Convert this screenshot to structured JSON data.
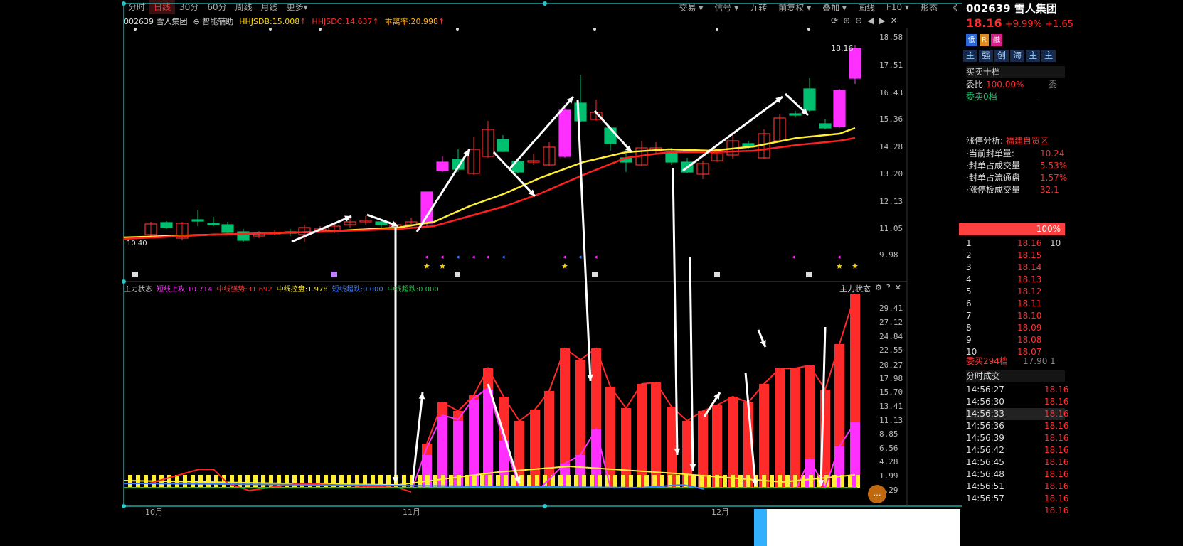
{
  "toolbar": {
    "tabs": [
      {
        "label": "分时"
      },
      {
        "label": "日线"
      },
      {
        "label": "30分"
      },
      {
        "label": "60分"
      },
      {
        "label": "周线"
      },
      {
        "label": "月线"
      },
      {
        "label": "更多▾"
      }
    ],
    "right": [
      {
        "label": "交易 ▾"
      },
      {
        "label": "信号 ▾"
      },
      {
        "label": "九转"
      },
      {
        "label": "前复权 ▾"
      },
      {
        "label": "叠加 ▾"
      },
      {
        "label": "画线"
      },
      {
        "label": "F10 ▾"
      },
      {
        "label": "形态"
      }
    ],
    "collapse": "《"
  },
  "infobar": {
    "code_name": "002639 雪人集团",
    "assist": "智能辅助",
    "hhjsdb": "HHJSDB:15.008",
    "hhjsdc": "HHJSDC:14.637",
    "deviation": "乖离率:20.998"
  },
  "main": {
    "y_ticks": [
      "18.58",
      "17.51",
      "16.43",
      "15.36",
      "14.28",
      "13.20",
      "12.13",
      "11.05",
      "9.98"
    ],
    "last_price_label": "18.16",
    "low_label": "10.40",
    "colors": {
      "up": "#ff2a2a",
      "down": "#00c070",
      "limit": "#ff30ff",
      "ma_fast": "#ffee33",
      "ma_slow": "#ff2020"
    }
  },
  "sub": {
    "title": "主力状态",
    "short_up": "短线上攻:10.714",
    "mid_strong": "中线强势:31.692",
    "mid_ctrl": "中线控盘:1.978",
    "short_fall": "短线超跌:0.000",
    "mid_fall": "中线超跌:0.000",
    "right_title": "主力状态",
    "y_ticks": [
      "29.41",
      "27.12",
      "24.84",
      "22.55",
      "20.27",
      "17.98",
      "15.70",
      "13.41",
      "11.13",
      "8.85",
      "6.56",
      "4.28",
      "1.99",
      "0.29"
    ]
  },
  "xaxis": {
    "labels": [
      "10月",
      "11月",
      "12月"
    ]
  },
  "side": {
    "code": "002639",
    "name": "雪人集团",
    "price": "18.16",
    "pct": "+9.99%",
    "chg": "+1.65",
    "tags": [
      "低",
      "R",
      "融"
    ],
    "tabs": [
      "主",
      "强",
      "创",
      "海",
      "主",
      "主"
    ],
    "order_title": "买卖十档",
    "commit_label": "委比",
    "commit_value": "100.00%",
    "commit_extra": "委",
    "sell0": "委卖0档",
    "sell0_val": "-",
    "limit_title": "涨停分析:",
    "limit_place": "福建自贸区",
    "stats": [
      {
        "k": "·当前封单量:",
        "v": "10.24"
      },
      {
        "k": "·封单占成交量",
        "v": "5.53%"
      },
      {
        "k": "·封单占流通盘",
        "v": "1.57%"
      },
      {
        "k": "·涨停板成交量",
        "v": "32.1"
      }
    ],
    "bar_pct": "100%",
    "buys": [
      {
        "n": "1",
        "p": "18.16",
        "q": "10"
      },
      {
        "n": "2",
        "p": "18.15",
        "q": ""
      },
      {
        "n": "3",
        "p": "18.14",
        "q": ""
      },
      {
        "n": "4",
        "p": "18.13",
        "q": ""
      },
      {
        "n": "5",
        "p": "18.12",
        "q": ""
      },
      {
        "n": "6",
        "p": "18.11",
        "q": ""
      },
      {
        "n": "7",
        "p": "18.10",
        "q": ""
      },
      {
        "n": "8",
        "p": "18.09",
        "q": ""
      },
      {
        "n": "9",
        "p": "18.08",
        "q": ""
      },
      {
        "n": "10",
        "p": "18.07",
        "q": ""
      }
    ],
    "buy_total": "委买294档",
    "buy_total_p": "17.90",
    "buy_total_q": "1",
    "trades_title": "分时成交",
    "trades": [
      {
        "t": "14:56:27",
        "p": "18.16"
      },
      {
        "t": "14:56:30",
        "p": "18.16"
      },
      {
        "t": "14:56:33",
        "p": "18.16"
      },
      {
        "t": "14:56:36",
        "p": "18.16"
      },
      {
        "t": "14:56:39",
        "p": "18.16"
      },
      {
        "t": "14:56:42",
        "p": "18.16"
      },
      {
        "t": "14:56:45",
        "p": "18.16"
      },
      {
        "t": "14:56:48",
        "p": "18.16"
      },
      {
        "t": "14:56:51",
        "p": "18.16"
      },
      {
        "t": "14:56:57",
        "p": "18.16"
      },
      {
        "t": "",
        "p": "18.16"
      }
    ]
  }
}
